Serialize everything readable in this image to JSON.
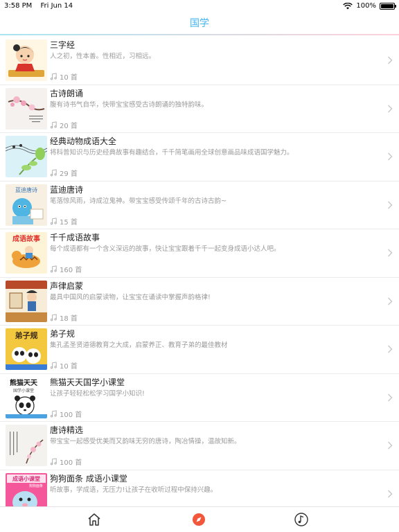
{
  "status_bar": {
    "time": "3:58 PM",
    "date": "Fri Jun 14",
    "battery": "100%"
  },
  "nav": {
    "title": "国学"
  },
  "items": [
    {
      "title": "三字经",
      "desc": "人之初，性本善。性相近，习相远。",
      "count": "10 首"
    },
    {
      "title": "古诗朗诵",
      "desc": "腹有诗书气自华，快带宝宝感受古诗朗诵的独特韵味。",
      "count": "20 首"
    },
    {
      "title": "经典动物成语大全",
      "desc": "将科普知识与历史经典故事有趣结合，千千简笔画用全球创意画品味成语国学魅力。",
      "count": "29 首"
    },
    {
      "title": "蓝迪唐诗",
      "desc": "笔落惊风雨，诗成泣鬼神。带宝宝感受传颂千年的古诗古韵~",
      "count": "15 首"
    },
    {
      "title": "千千成语故事",
      "desc": "每个成语都有一个含义深远的故事，快让宝宝跟着千千一起变身成语小达人吧。",
      "count": "160 首"
    },
    {
      "title": "声律启蒙",
      "desc": "最具中国风的启蒙读物，让宝宝在诵读中掌握声韵格律!",
      "count": "18 首"
    },
    {
      "title": "弟子规",
      "desc": "集孔孟圣贤道德教育之大成，启蒙养正、教育子弟的最佳教材",
      "count": "10 首"
    },
    {
      "title": "熊猫天天国学小课堂",
      "desc": "让孩子轻轻松松学习国学小知识!",
      "count": "100 首"
    },
    {
      "title": "唐诗精选",
      "desc": "带宝宝一起感受优美而又韵味无穷的唐诗，陶冶情操，温故知新。",
      "count": "100 首"
    },
    {
      "title": "狗狗面条 成语小课堂",
      "desc": "听故事，学成语，无压力!让孩子在收听过程中保持兴趣。",
      "count": ""
    }
  ],
  "thumb_text": {
    "t4": "蓝迪唐诗",
    "t5": "成语故事",
    "t7": "弟子规",
    "t8": "熊猫天天",
    "t8_sub": "国学小课堂",
    "t10": "成语小课堂",
    "t10_sub": "狗狗面条"
  },
  "tabs": [
    {
      "name": "home",
      "icon": "home-icon"
    },
    {
      "name": "discover",
      "icon": "compass-icon"
    },
    {
      "name": "music",
      "icon": "music-note-icon"
    }
  ],
  "colors": {
    "accent": "#41b6ef",
    "discover_active": "#f2563b",
    "text_secondary": "#9a9a9a"
  }
}
